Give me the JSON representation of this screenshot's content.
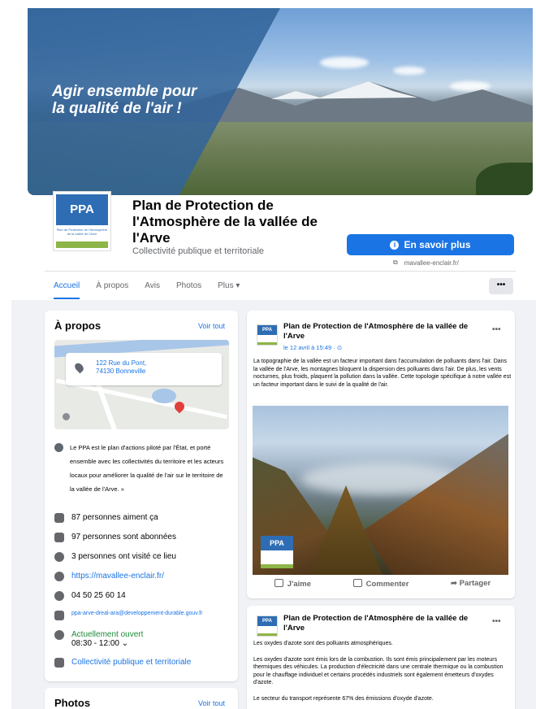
{
  "cover": {
    "slogan_line1": "Agir ensemble pour",
    "slogan_line2": "la qualité de l'air !"
  },
  "logo": {
    "abbr": "PPA",
    "subtitle": "Plan de Protection de l'Atmosphère de la vallée de l'Arve"
  },
  "page": {
    "name": "Plan de Protection de l'Atmosphère de la vallée de l'Arve",
    "category": "Collectivité publique et territoriale",
    "cta_label": "En savoir plus",
    "website_short": "mavallee-enclair.fr/"
  },
  "tabs": [
    "Accueil",
    "À propos",
    "Avis",
    "Photos",
    "Plus ▾"
  ],
  "tab_more_dots": "•••",
  "about": {
    "title": "À propos",
    "see_all": "Voir tout",
    "address_line1": "122 Rue du Pont,",
    "address_line2": "74130 Bonneville",
    "description": "Le PPA est le plan d'actions piloté par l'État, et porté ensemble avec les collectivités du territoire et les acteurs locaux pour améliorer la qualité de l'air sur le territoire de la vallée de l'Arve. »",
    "likes": "87 personnes aiment ça",
    "followers": "97 personnes sont abonnées",
    "checkins": "3 personnes ont visité ce lieu",
    "website": "https://mavallee-enclair.fr/",
    "phone": "04 50 25 60 14",
    "email": "ppa-arve-dreal-ara@developpement-durable.gouv.fr",
    "status": "Actuellement ouvert",
    "hours": "08:30 - 12:00 ⌄",
    "category": "Collectivité publique et territoriale"
  },
  "photos": {
    "title": "Photos",
    "see_all": "Voir tout"
  },
  "post1": {
    "author": "Plan de Protection de l'Atmosphère de la vallée de l'Arve",
    "date": "le 12 avril à 15:49 · ⊙",
    "text": "La topographie de la vallée est un facteur important dans l'accumulation de polluants dans l'air. Dans la vallée de l'Arve, les montagnes bloquent la dispersion des polluants dans l'air. De plus, les vents nocturnes, plus froids, plaquent la pollution dans la vallée. Cette topologie spécifique à notre vallée est un facteur important dans le suivi de la qualité de l'air.",
    "like": "J'aime",
    "comment": "Commenter",
    "share": "Partager"
  },
  "post2": {
    "author": "Plan de Protection de l'Atmosphère de la vallée de l'Arve",
    "p1": "Les oxydes d'azote sont des polluants atmosphériques.",
    "p2": "Les oxydes d'azote sont émis lors de la combustion. Ils sont émis principalement par les moteurs thermiques des véhicules. La production d'électricité dans une centrale thermique ou la combustion pour le chauffage individuel et certains procédés industriels sont également émetteurs d'oxydes d'azote.",
    "p3": "Le secteur du transport représente 67% des émissions d'oxyde d'azote."
  },
  "colors": {
    "accent": "#1b74e4",
    "brand_blue": "#2e6db3",
    "brand_green": "#8db547",
    "open_green": "#1f8a3a"
  }
}
